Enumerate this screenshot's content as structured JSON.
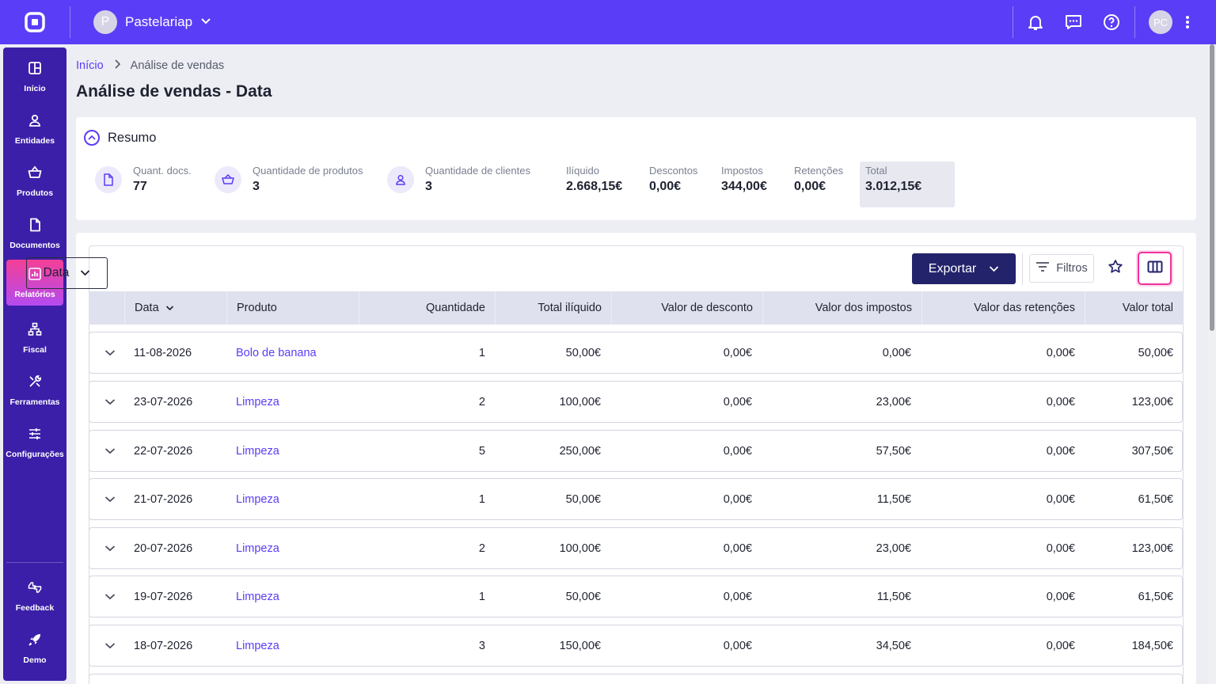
{
  "header": {
    "company_initial": "P",
    "company_name": "Pastelariap",
    "user_initials": "PC",
    "icons": [
      "app-logo-icon",
      "bell-icon",
      "chat-icon",
      "help-icon",
      "kebab-menu-icon"
    ]
  },
  "sidebar": {
    "items": [
      {
        "label": "Início",
        "icon": "dashboard-icon"
      },
      {
        "label": "Entidades",
        "icon": "user-icon"
      },
      {
        "label": "Produtos",
        "icon": "basket-icon"
      },
      {
        "label": "Documentos",
        "icon": "document-icon"
      },
      {
        "label": "Relatórios",
        "icon": "chart-icon",
        "active": true
      },
      {
        "label": "Fiscal",
        "icon": "fiscal-icon"
      },
      {
        "label": "Ferramentas",
        "icon": "tools-icon"
      },
      {
        "label": "Configurações",
        "icon": "sliders-icon"
      }
    ],
    "bottom": [
      {
        "label": "Feedback",
        "icon": "feedback-icon"
      },
      {
        "label": "Demo",
        "icon": "rocket-icon"
      }
    ]
  },
  "breadcrumb": {
    "home": "Início",
    "current": "Análise de vendas"
  },
  "page": {
    "title": "Análise de vendas - Data"
  },
  "summary": {
    "title": "Resumo",
    "stats": [
      {
        "label": "Quant. docs.",
        "value": "77"
      },
      {
        "label": "Quantidade de produtos",
        "value": "3"
      },
      {
        "label": "Quantidade de clientes",
        "value": "3"
      },
      {
        "label": "Ilíquido",
        "value": "2.668,15€"
      },
      {
        "label": "Descontos",
        "value": "0,00€"
      },
      {
        "label": "Impostos",
        "value": "344,00€"
      },
      {
        "label": "Retenções",
        "value": "0,00€"
      },
      {
        "label": "Total",
        "value": "3.012,15€"
      }
    ]
  },
  "toolbar": {
    "group_by": "Data",
    "export_label": "Exportar",
    "filters_label": "Filtros"
  },
  "table": {
    "columns": [
      "Data",
      "Produto",
      "Quantidade",
      "Total ilíquido",
      "Valor de desconto",
      "Valor dos impostos",
      "Valor das retenções",
      "Valor total"
    ],
    "rows": [
      [
        "11-08-2026",
        "Bolo de banana",
        "1",
        "50,00€",
        "0,00€",
        "0,00€",
        "0,00€",
        "50,00€"
      ],
      [
        "23-07-2026",
        "Limpeza",
        "2",
        "100,00€",
        "0,00€",
        "23,00€",
        "0,00€",
        "123,00€"
      ],
      [
        "22-07-2026",
        "Limpeza",
        "5",
        "250,00€",
        "0,00€",
        "57,50€",
        "0,00€",
        "307,50€"
      ],
      [
        "21-07-2026",
        "Limpeza",
        "1",
        "50,00€",
        "0,00€",
        "11,50€",
        "0,00€",
        "61,50€"
      ],
      [
        "20-07-2026",
        "Limpeza",
        "2",
        "100,00€",
        "0,00€",
        "23,00€",
        "0,00€",
        "123,00€"
      ],
      [
        "19-07-2026",
        "Limpeza",
        "1",
        "50,00€",
        "0,00€",
        "11,50€",
        "0,00€",
        "61,50€"
      ],
      [
        "18-07-2026",
        "Limpeza",
        "3",
        "150,00€",
        "0,00€",
        "34,50€",
        "0,00€",
        "184,50€"
      ]
    ]
  },
  "colors": {
    "primary": "#5a3df6",
    "sidebar": "#3b1fa8",
    "export": "#23236b",
    "highlight": "#f0319b"
  }
}
